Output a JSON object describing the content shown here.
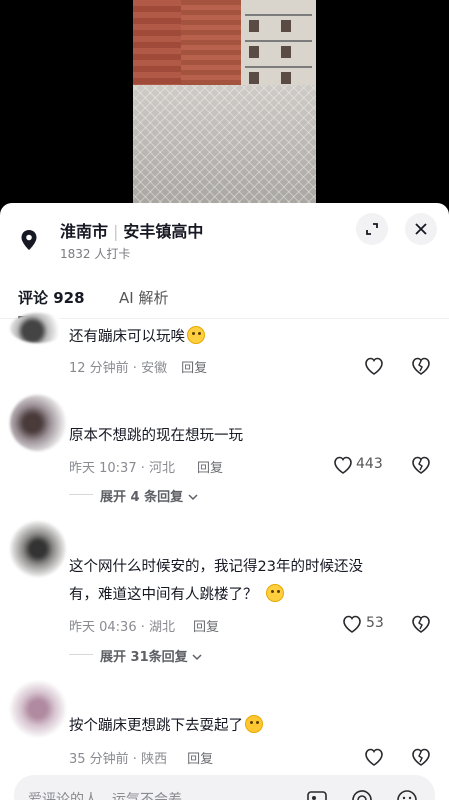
{
  "location": {
    "city": "淮南市",
    "place": "安丰镇高中",
    "checkins": "1832 人打卡"
  },
  "tabs": {
    "comments_label": "评论",
    "comments_count": "928",
    "ai_label": "AI 解析"
  },
  "comments": [
    {
      "text": "还有蹦床可以玩唉",
      "time": "12 分钟前 · 安徽",
      "reply_label": "回复",
      "likes": "",
      "emoji": "smirk-emoji"
    },
    {
      "text": "原本不想跳的现在想玩一玩",
      "time": "昨天 10:37 · 河北",
      "reply_label": "回复",
      "likes": "443",
      "expand_label": "展开 4 条回复"
    },
    {
      "text_line1": "这个网什么时候安的，我记得23年的时候还没",
      "text_line2": "有，难道这中间有人跳楼了？",
      "time": "昨天 04:36 · 湖北",
      "reply_label": "回复",
      "likes": "53",
      "expand_label": "展开 31条回复",
      "emoji": "thinking-emoji"
    },
    {
      "text": "按个蹦床更想跳下去耍起了",
      "time": "35 分钟前 · 陕西",
      "reply_label": "回复",
      "likes": "",
      "emoji": "crying-emoji"
    }
  ],
  "input": {
    "placeholder": "爱评论的人，运气不会差"
  },
  "icons": {
    "location": "location-pin-icon",
    "expand": "expand-icon",
    "close": "close-icon",
    "like": "heart-icon",
    "dislike": "broken-heart-icon",
    "chevron": "chevron-down-icon",
    "image": "image-icon",
    "mention": "at-icon",
    "emoji": "emoji-icon"
  }
}
